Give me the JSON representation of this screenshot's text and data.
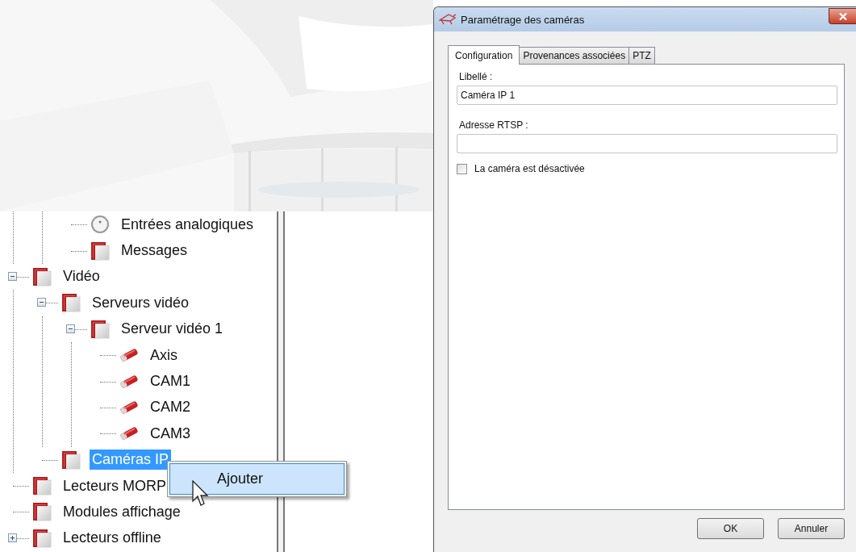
{
  "tree": {
    "items": [
      {
        "children": [
          {
            "children": [
              {
                "label": "Entrées analogiques",
                "kind": "input",
                "selected": false
              },
              {
                "label": "Messages",
                "kind": "folder",
                "selected": false
              }
            ]
          }
        ]
      },
      {
        "label": "Vidéo",
        "kind": "folder",
        "selected": false,
        "expanded": true,
        "children": [
          {
            "label": "Serveurs vidéo",
            "kind": "folder",
            "selected": false,
            "expanded": true,
            "children": [
              {
                "label": "Serveur vidéo 1",
                "kind": "folder",
                "selected": false,
                "expanded": true,
                "children": [
                  {
                    "label": "Axis",
                    "kind": "camera",
                    "selected": false
                  },
                  {
                    "label": "CAM1",
                    "kind": "camera",
                    "selected": false
                  },
                  {
                    "label": "CAM2",
                    "kind": "camera",
                    "selected": false
                  },
                  {
                    "label": "CAM3",
                    "kind": "camera",
                    "selected": false
                  }
                ]
              }
            ]
          },
          {
            "label": "Caméras IP",
            "kind": "folder",
            "selected": true
          }
        ]
      },
      {
        "label": "Lecteurs MORP",
        "kind": "folder",
        "selected": false
      },
      {
        "label": "Modules affichage",
        "kind": "folder",
        "selected": false
      },
      {
        "label": "Lecteurs offline",
        "kind": "folder",
        "selected": false,
        "expanded": false
      }
    ]
  },
  "context_menu": {
    "items": [
      {
        "label": "Ajouter",
        "selected": true
      }
    ]
  },
  "dialog": {
    "title": "Paramétrage des caméras",
    "tabs": [
      {
        "label": "Configuration",
        "selected": true
      },
      {
        "label": "Provenances associées",
        "selected": false
      },
      {
        "label": "PTZ",
        "selected": false
      }
    ],
    "fields": [
      {
        "label": "Libellé :",
        "value": "Caméra IP 1"
      },
      {
        "label": "Adresse RTSP :"
      }
    ],
    "checkbox": {
      "label": "La caméra est désactivée",
      "checked": false
    },
    "buttons": [
      "OK",
      "Annuler"
    ]
  }
}
